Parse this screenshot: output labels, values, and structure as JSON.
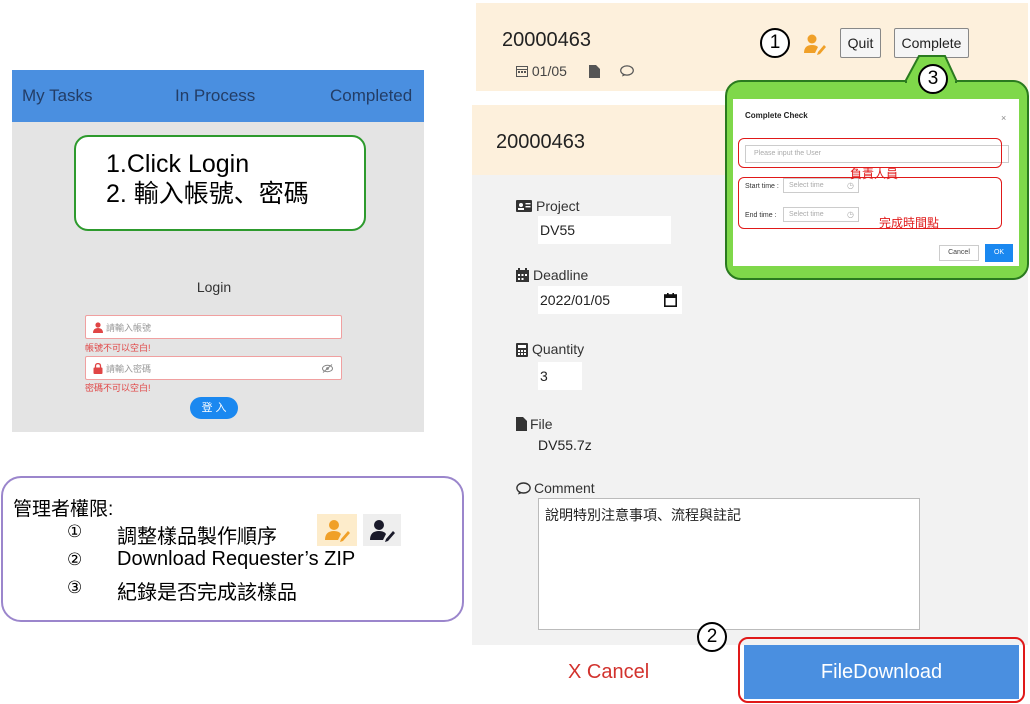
{
  "mobile": {
    "nav": [
      "My Tasks",
      "In Process",
      "Completed"
    ],
    "callout": [
      "1.Click Login",
      "2. 輸入帳號、密碼"
    ],
    "login_title": "Login",
    "username_placeholder": "請輸入帳號",
    "username_error": "帳號不可以空白!",
    "password_placeholder": "請輸入密碼",
    "password_error": "密碼不可以空白!",
    "login_button": "登 入"
  },
  "permissions": {
    "title": "管理者權限:",
    "items": [
      {
        "num": "①",
        "text": "調整樣品製作順序"
      },
      {
        "num": "②",
        "text": "Download Requester’s ZIP"
      },
      {
        "num": "③",
        "text": "紀錄是否完成該樣品"
      }
    ]
  },
  "task_card": {
    "id": "20000463",
    "date": "01/05",
    "quit_label": "Quit",
    "complete_label": "Complete",
    "step1": "1",
    "step2": "2",
    "step3": "3"
  },
  "detail": {
    "id": "20000463",
    "project_label": "Project",
    "project_value": "DV55",
    "deadline_label": "Deadline",
    "deadline_value": "2022/01/05",
    "quantity_label": "Quantity",
    "quantity_value": "3",
    "file_label": "File",
    "file_value": "DV55.7z",
    "comment_label": "Comment",
    "comment_value": "說明特別注意事項、流程與註記",
    "cancel_label": "X  Cancel",
    "download_label": "FileDownload"
  },
  "dialog": {
    "title": "Complete Check",
    "close": "×",
    "user_placeholder": "Please input the User",
    "start_label": "Start time :",
    "end_label": "End time :",
    "time_placeholder": "Select time",
    "cancel": "Cancel",
    "ok": "OK",
    "note_user": "負責人員",
    "note_time": "完成時間點"
  },
  "colors": {
    "accent_blue": "#4a8fe0",
    "highlight_red": "#e01919",
    "callout_green": "#7fd84a",
    "card_beige": "#fdf0dc"
  }
}
